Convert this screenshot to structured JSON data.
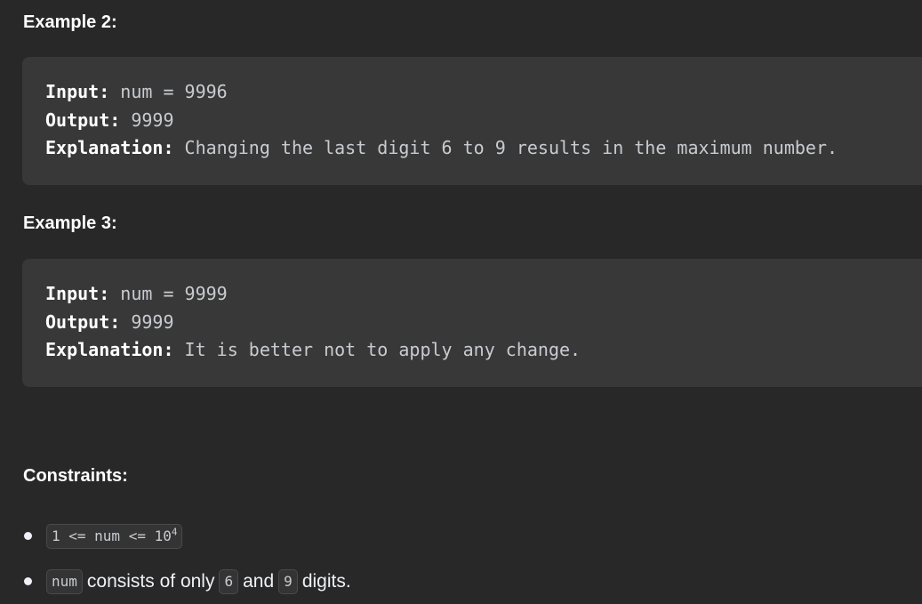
{
  "example2": {
    "heading": "Example 2:",
    "input_label": "Input:",
    "input_value": "num = 9996",
    "output_label": "Output:",
    "output_value": "9999",
    "explanation_label": "Explanation:",
    "explanation_value": "Changing the last digit 6 to 9 results in the maximum number."
  },
  "example3": {
    "heading": "Example 3:",
    "input_label": "Input:",
    "input_value": "num = 9999",
    "output_label": "Output:",
    "output_value": "9999",
    "explanation_label": "Explanation:",
    "explanation_value": "It is better not to apply any change."
  },
  "constraints": {
    "heading": "Constraints:",
    "item1": {
      "code": "1 <= num <= 10",
      "sup": "4"
    },
    "item2": {
      "code_num": "num",
      "text_a": "consists of only",
      "code_6": "6",
      "text_b": "and",
      "code_9": "9",
      "text_c": "digits."
    }
  }
}
